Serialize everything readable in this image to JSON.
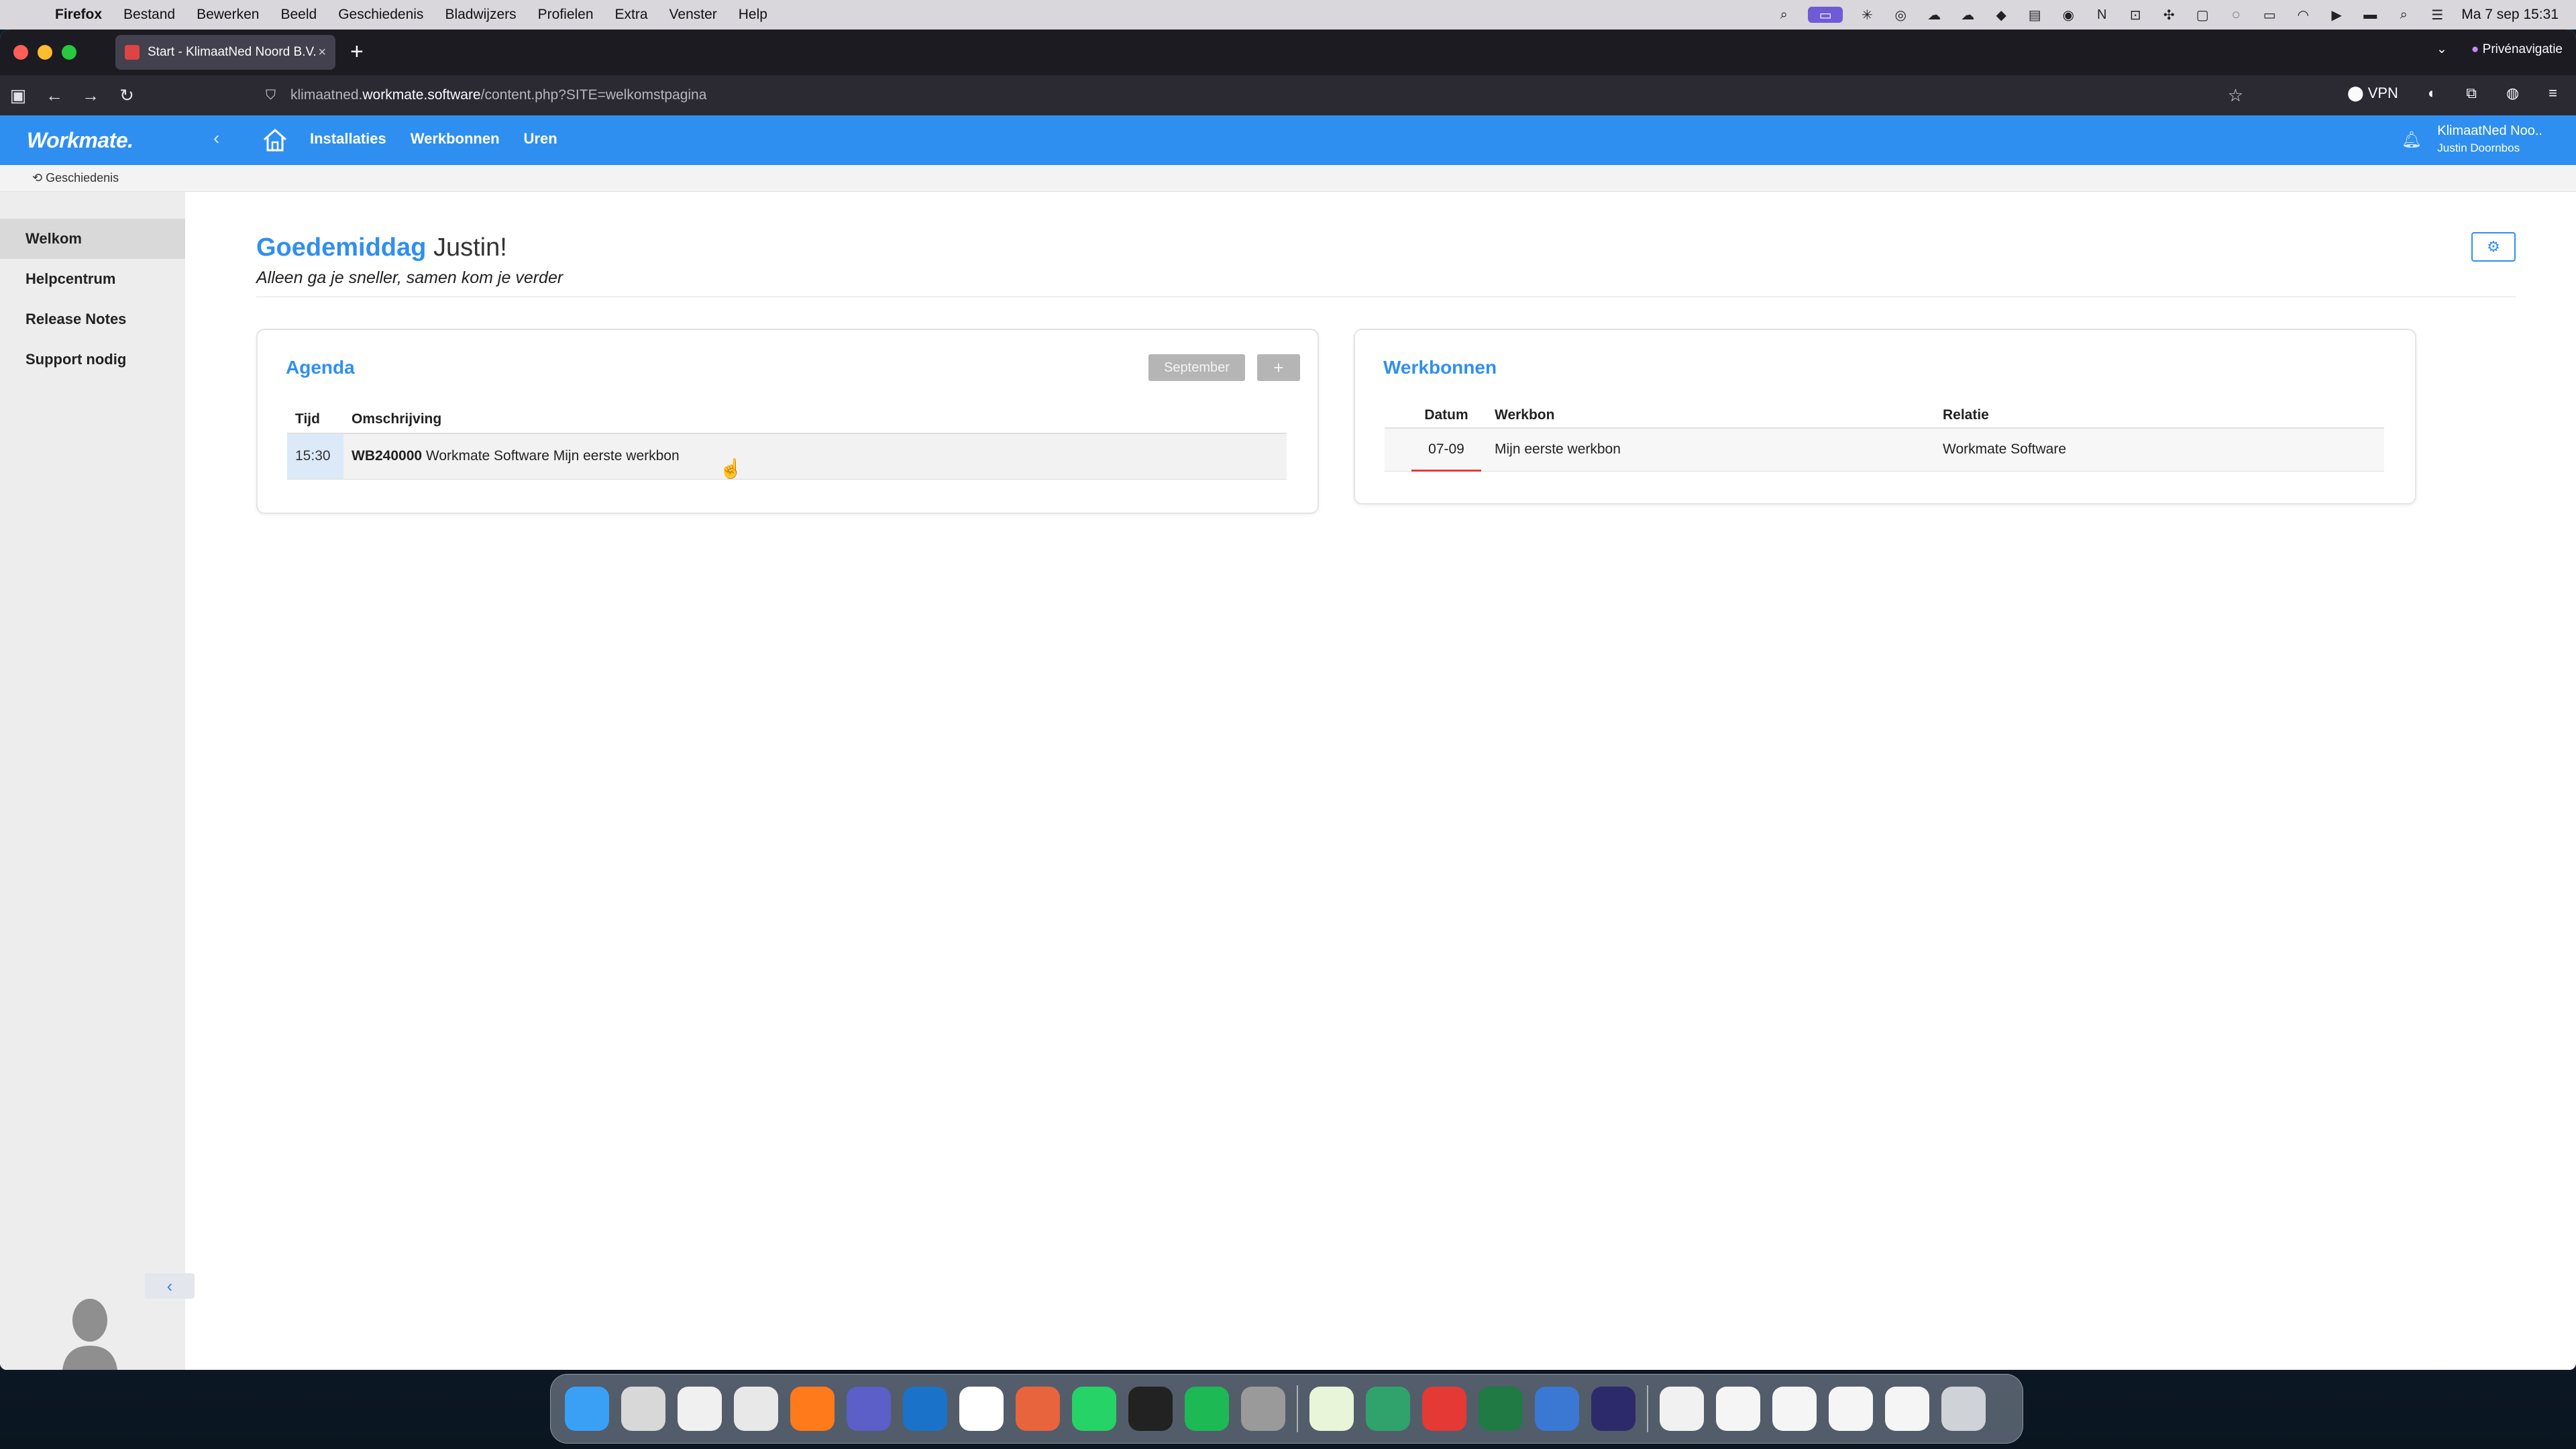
{
  "menubar": {
    "app": "Firefox",
    "items": [
      "Bestand",
      "Bewerken",
      "Beeld",
      "Geschiedenis",
      "Bladwijzers",
      "Profielen",
      "Extra",
      "Venster",
      "Help"
    ],
    "clock": "Ma 7 sep  15:31"
  },
  "browser": {
    "tab_title": "Start - KlimaatNed Noord B.V.",
    "private_label": "Privénavigatie",
    "url_prefix": "klimaatned.",
    "url_domain": "workmate.software",
    "url_path": "/content.php?SITE=welkomstpagina",
    "vpn_label": "VPN"
  },
  "app": {
    "logo": "Workmate.",
    "nav": [
      "Installaties",
      "Werkbonnen",
      "Uren"
    ],
    "user_company": "KlimaatNed Noo..",
    "user_name": "Justin Doornbos",
    "breadcrumb": "Geschiedenis"
  },
  "sidebar": {
    "items": [
      {
        "label": "Welkom",
        "active": true
      },
      {
        "label": "Helpcentrum",
        "active": false
      },
      {
        "label": "Release Notes",
        "active": false
      },
      {
        "label": "Support nodig",
        "active": false
      }
    ]
  },
  "welcome": {
    "greeting": "Goedemiddag",
    "name": "Justin!",
    "tagline": "Alleen ga je sneller, samen kom je verder"
  },
  "agenda": {
    "title": "Agenda",
    "month_button": "September",
    "add_button": "+",
    "columns": [
      "Tijd",
      "Omschrijving"
    ],
    "rows": [
      {
        "time": "15:30",
        "code": "WB240000",
        "description": "Workmate Software Mijn eerste werkbon"
      }
    ]
  },
  "werkbonnen": {
    "title": "Werkbonnen",
    "columns": [
      "Datum",
      "Werkbon",
      "Relatie"
    ],
    "rows": [
      {
        "date": "07-09",
        "werkbon": "Mijn eerste werkbon",
        "relatie": "Workmate Software"
      }
    ]
  },
  "colors": {
    "primary": "#2f8ff0",
    "sidebar_bg": "#ededed",
    "date_underline": "#e43c3c"
  },
  "dock_apps": [
    {
      "name": "finder",
      "color": "#3aa0f5"
    },
    {
      "name": "launchpad",
      "color": "#d8d8d8"
    },
    {
      "name": "reminders",
      "color": "#f0f0f0"
    },
    {
      "name": "chrome",
      "color": "#e8e8e8"
    },
    {
      "name": "firefox",
      "color": "#ff7a1a"
    },
    {
      "name": "teams",
      "color": "#5b5fc7"
    },
    {
      "name": "outlook",
      "color": "#1a73c8"
    },
    {
      "name": "notion",
      "color": "#ffffff"
    },
    {
      "name": "claude",
      "color": "#e8643c"
    },
    {
      "name": "whatsapp",
      "color": "#25d366"
    },
    {
      "name": "voice-memos",
      "color": "#222222"
    },
    {
      "name": "spotify",
      "color": "#1db954"
    },
    {
      "name": "system-settings",
      "color": "#9a9a9a"
    },
    {
      "name": "chatgpt",
      "color": "#e9f5d9"
    },
    {
      "name": "app-green",
      "color": "#2fa36b"
    },
    {
      "name": "pdf",
      "color": "#e53935"
    },
    {
      "name": "excel",
      "color": "#1f7a44"
    },
    {
      "name": "app-blue",
      "color": "#3a78d4"
    },
    {
      "name": "app-g",
      "color": "#2d2a6b"
    },
    {
      "name": "folder",
      "color": "#f1f1f1"
    },
    {
      "name": "doc-1",
      "color": "#f5f5f5"
    },
    {
      "name": "doc-2",
      "color": "#f5f5f5"
    },
    {
      "name": "doc-3",
      "color": "#f5f5f5"
    },
    {
      "name": "doc-4",
      "color": "#f5f5f5"
    },
    {
      "name": "trash",
      "color": "#cfd3d8"
    }
  ]
}
